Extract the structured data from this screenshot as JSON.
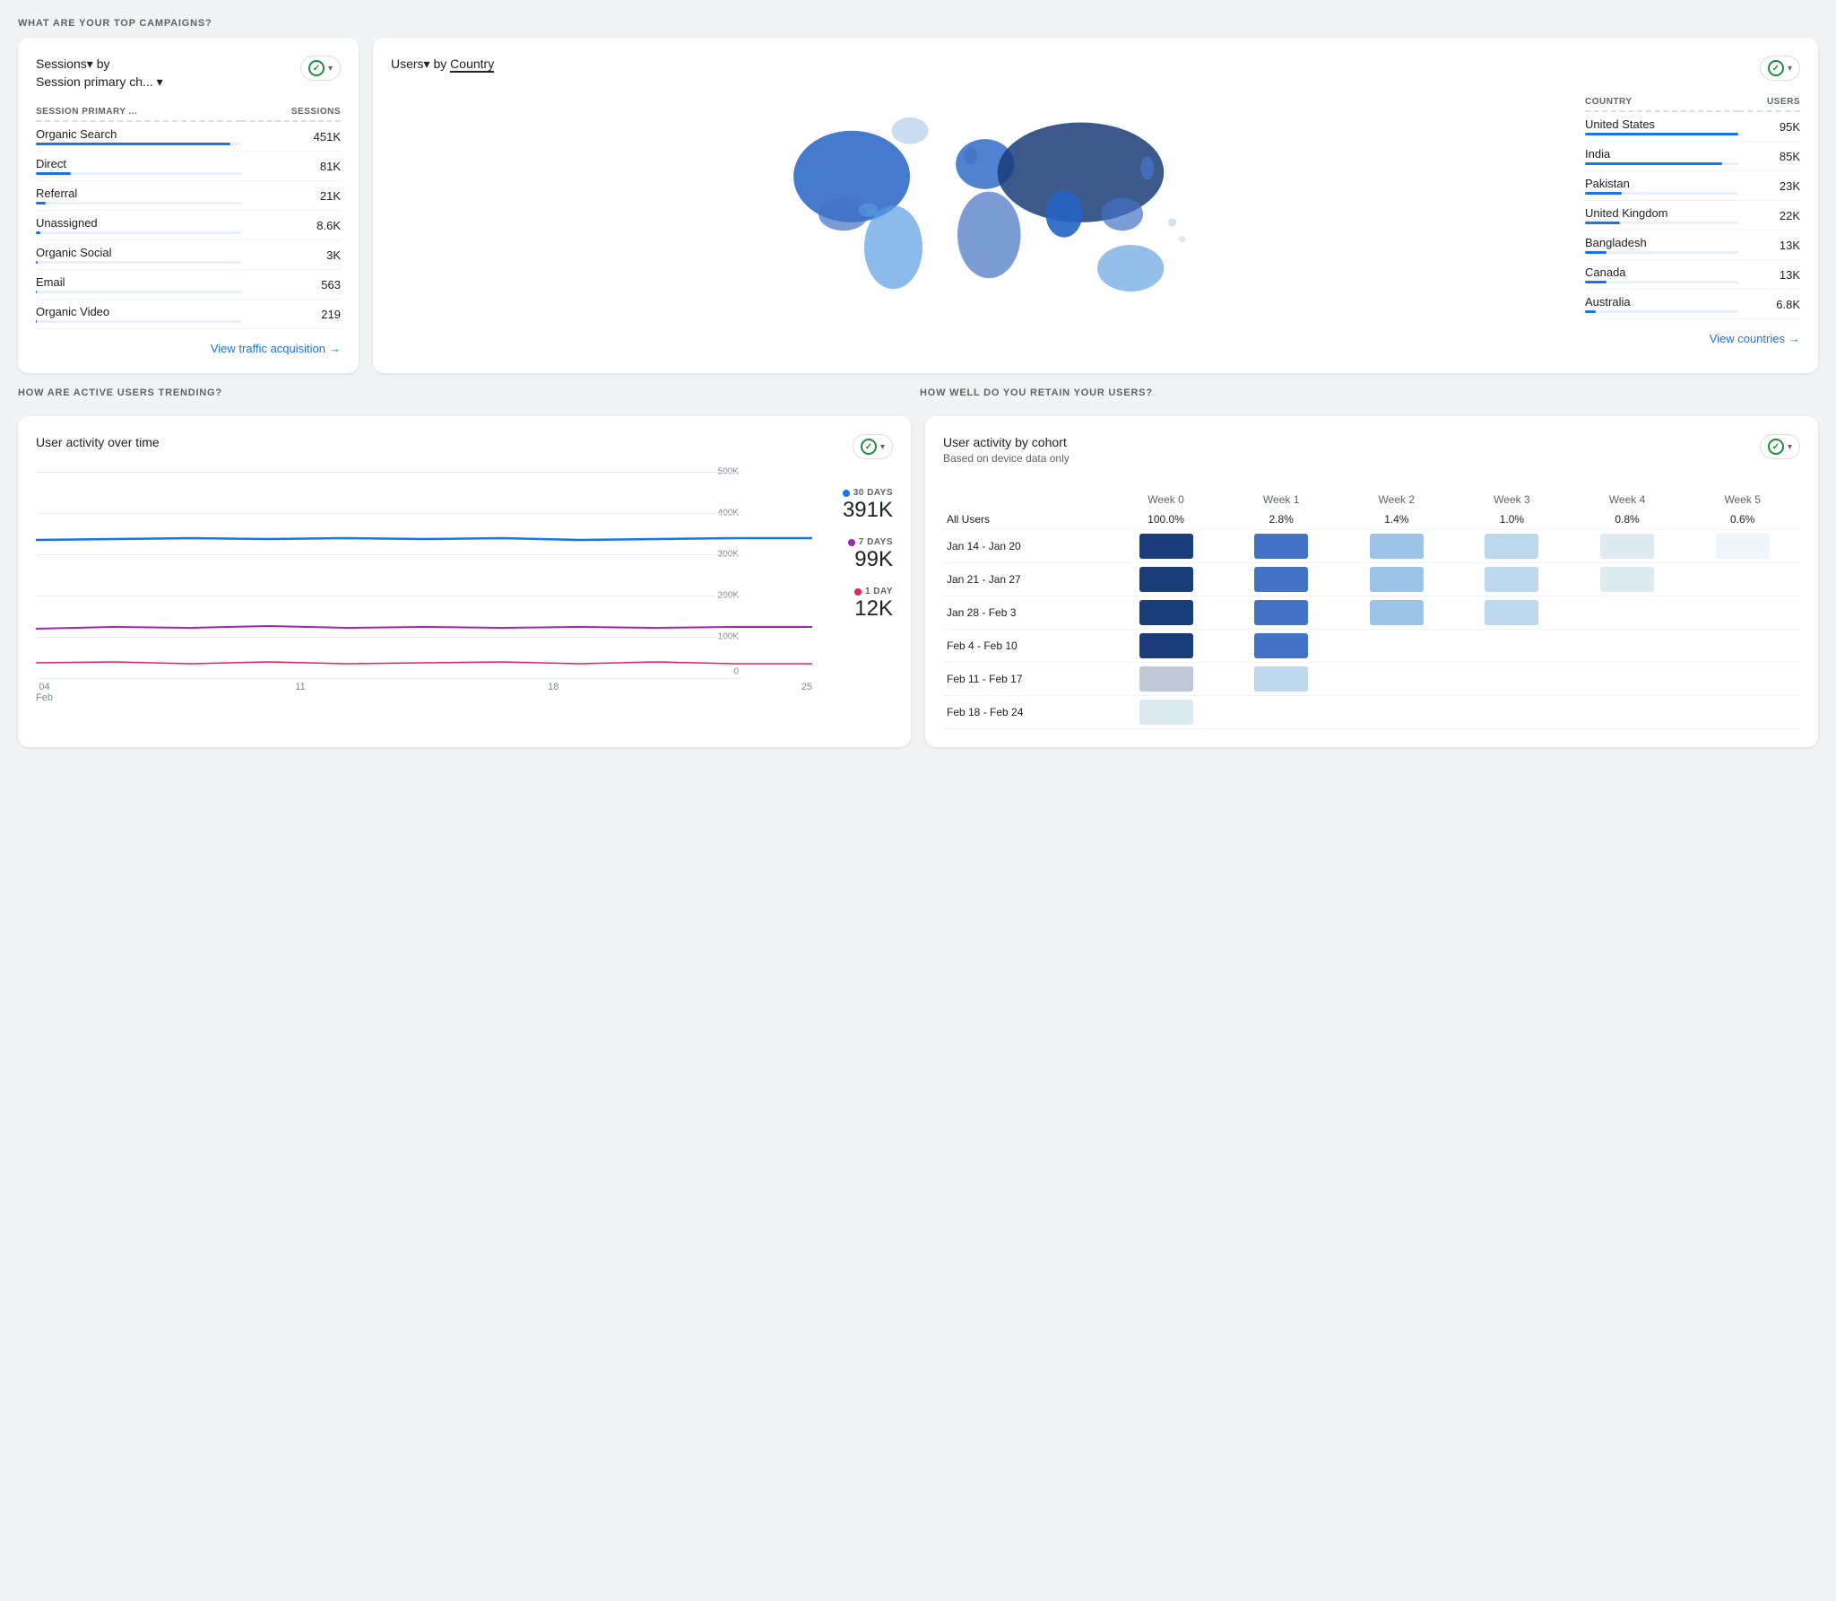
{
  "page": {
    "section1_title": "WHAT ARE YOUR TOP CAMPAIGNS?",
    "section2_title": "HOW ARE ACTIVE USERS TRENDING?",
    "section3_title": "HOW WELL DO YOU RETAIN YOUR USERS?"
  },
  "campaigns_card": {
    "title_part1": "Sessions",
    "title_part2": "by",
    "title_part3": "Session primary ch...",
    "col1_header": "SESSION PRIMARY ...",
    "col2_header": "SESSIONS",
    "rows": [
      {
        "label": "Organic Search",
        "value": "451K",
        "bar_pct": 95
      },
      {
        "label": "Direct",
        "value": "81K",
        "bar_pct": 17
      },
      {
        "label": "Referral",
        "value": "21K",
        "bar_pct": 5
      },
      {
        "label": "Unassigned",
        "value": "8.6K",
        "bar_pct": 2
      },
      {
        "label": "Organic Social",
        "value": "3K",
        "bar_pct": 0.8
      },
      {
        "label": "Email",
        "value": "563",
        "bar_pct": 0.15
      },
      {
        "label": "Organic Video",
        "value": "219",
        "bar_pct": 0.05
      }
    ],
    "view_link": "View traffic acquisition"
  },
  "country_card": {
    "title_part1": "Users",
    "title_part2": "by",
    "title_part3": "Country",
    "col1_header": "COUNTRY",
    "col2_header": "USERS",
    "rows": [
      {
        "label": "United States",
        "value": "95K",
        "bar_pct": 100
      },
      {
        "label": "India",
        "value": "85K",
        "bar_pct": 89
      },
      {
        "label": "Pakistan",
        "value": "23K",
        "bar_pct": 24
      },
      {
        "label": "United Kingdom",
        "value": "22K",
        "bar_pct": 23
      },
      {
        "label": "Bangladesh",
        "value": "13K",
        "bar_pct": 14
      },
      {
        "label": "Canada",
        "value": "13K",
        "bar_pct": 14
      },
      {
        "label": "Australia",
        "value": "6.8K",
        "bar_pct": 7
      }
    ],
    "view_link": "View countries"
  },
  "activity_card": {
    "title": "User activity over time",
    "legend": [
      {
        "label": "30 DAYS",
        "value": "391K",
        "color": "#1a73e8"
      },
      {
        "label": "7 DAYS",
        "value": "99K",
        "color": "#9c27b0"
      },
      {
        "label": "1 DAY",
        "value": "12K",
        "color": "#e91e63"
      }
    ],
    "x_labels": [
      "04",
      "11",
      "18",
      "25"
    ],
    "x_sublabels": [
      "Feb",
      "",
      "",
      ""
    ],
    "y_labels": [
      "500K",
      "400K",
      "300K",
      "200K",
      "100K",
      "0"
    ]
  },
  "cohort_card": {
    "title": "User activity by cohort",
    "subtitle": "Based on device data only",
    "col_headers": [
      "Week 0",
      "Week 1",
      "Week 2",
      "Week 3",
      "Week 4",
      "Week 5"
    ],
    "all_users_row": {
      "label": "All Users",
      "values": [
        "100.0%",
        "2.8%",
        "1.4%",
        "1.0%",
        "0.8%",
        "0.6%"
      ]
    },
    "rows": [
      {
        "label": "Jan 14 - Jan 20",
        "cells": 6
      },
      {
        "label": "Jan 21 - Jan 27",
        "cells": 5
      },
      {
        "label": "Jan 28 - Feb 3",
        "cells": 4
      },
      {
        "label": "Feb 4 - Feb 10",
        "cells": 2
      },
      {
        "label": "Feb 11 - Feb 17",
        "cells": 2
      },
      {
        "label": "Feb 18 - Feb 24",
        "cells": 1
      }
    ]
  },
  "colors": {
    "accent_blue": "#1a73e8",
    "accent_purple": "#9c27b0",
    "accent_pink": "#e91e63",
    "check_green": "#1e8e3e",
    "cohort_dark": "#1a3c78",
    "cohort_mid": "#4472c4",
    "cohort_light": "#9dc3e6",
    "cohort_lighter": "#bdd7ee",
    "cohort_lightest": "#deeaf1",
    "map_dark": "#1a3c78",
    "map_mid": "#2563c4",
    "map_light": "#5b9de1",
    "map_lighter": "#aac4e8"
  }
}
